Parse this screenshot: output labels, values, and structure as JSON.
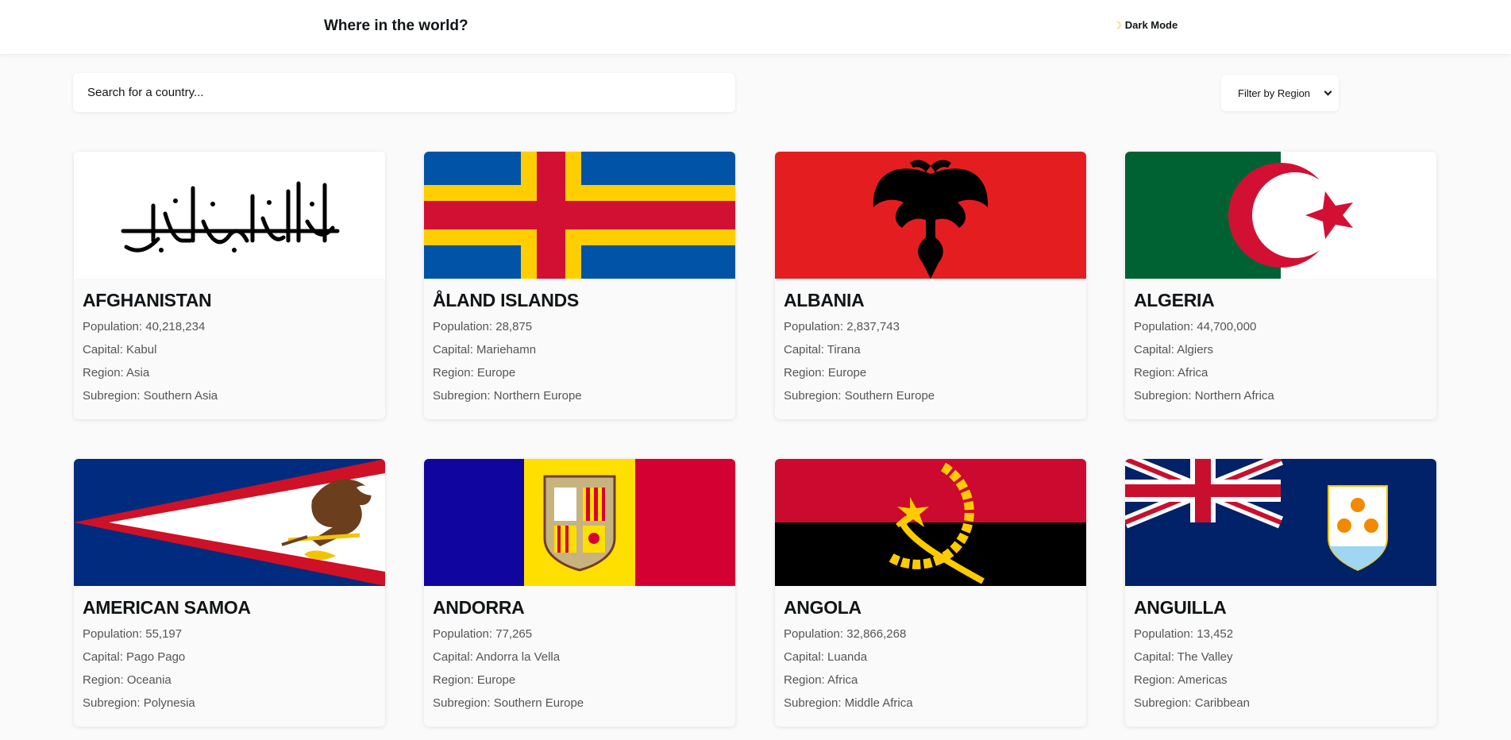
{
  "header": {
    "title": "Where in the world?",
    "dark_mode_label": "Dark Mode",
    "dark_mode_icon": "moon-icon"
  },
  "search": {
    "placeholder": "Search for a country..."
  },
  "filter": {
    "selected": "Filter by Region"
  },
  "labels": {
    "population": "Population: ",
    "capital": "Capital: ",
    "region": "Region: ",
    "subregion": "Subregion: "
  },
  "countries": [
    {
      "name": "AFGHANISTAN",
      "population": "40,218,234",
      "capital": "Kabul",
      "region": "Asia",
      "subregion": "Southern Asia"
    },
    {
      "name": "ÅLAND ISLANDS",
      "population": "28,875",
      "capital": "Mariehamn",
      "region": "Europe",
      "subregion": "Northern Europe"
    },
    {
      "name": "ALBANIA",
      "population": "2,837,743",
      "capital": "Tirana",
      "region": "Europe",
      "subregion": "Southern Europe"
    },
    {
      "name": "ALGERIA",
      "population": "44,700,000",
      "capital": "Algiers",
      "region": "Africa",
      "subregion": "Northern Africa"
    },
    {
      "name": "AMERICAN SAMOA",
      "population": "55,197",
      "capital": "Pago Pago",
      "region": "Oceania",
      "subregion": "Polynesia"
    },
    {
      "name": "ANDORRA",
      "population": "77,265",
      "capital": "Andorra la Vella",
      "region": "Europe",
      "subregion": "Southern Europe"
    },
    {
      "name": "ANGOLA",
      "population": "32,866,268",
      "capital": "Luanda",
      "region": "Africa",
      "subregion": "Middle Africa"
    },
    {
      "name": "ANGUILLA",
      "population": "13,452",
      "capital": "The Valley",
      "region": "Americas",
      "subregion": "Caribbean"
    }
  ]
}
